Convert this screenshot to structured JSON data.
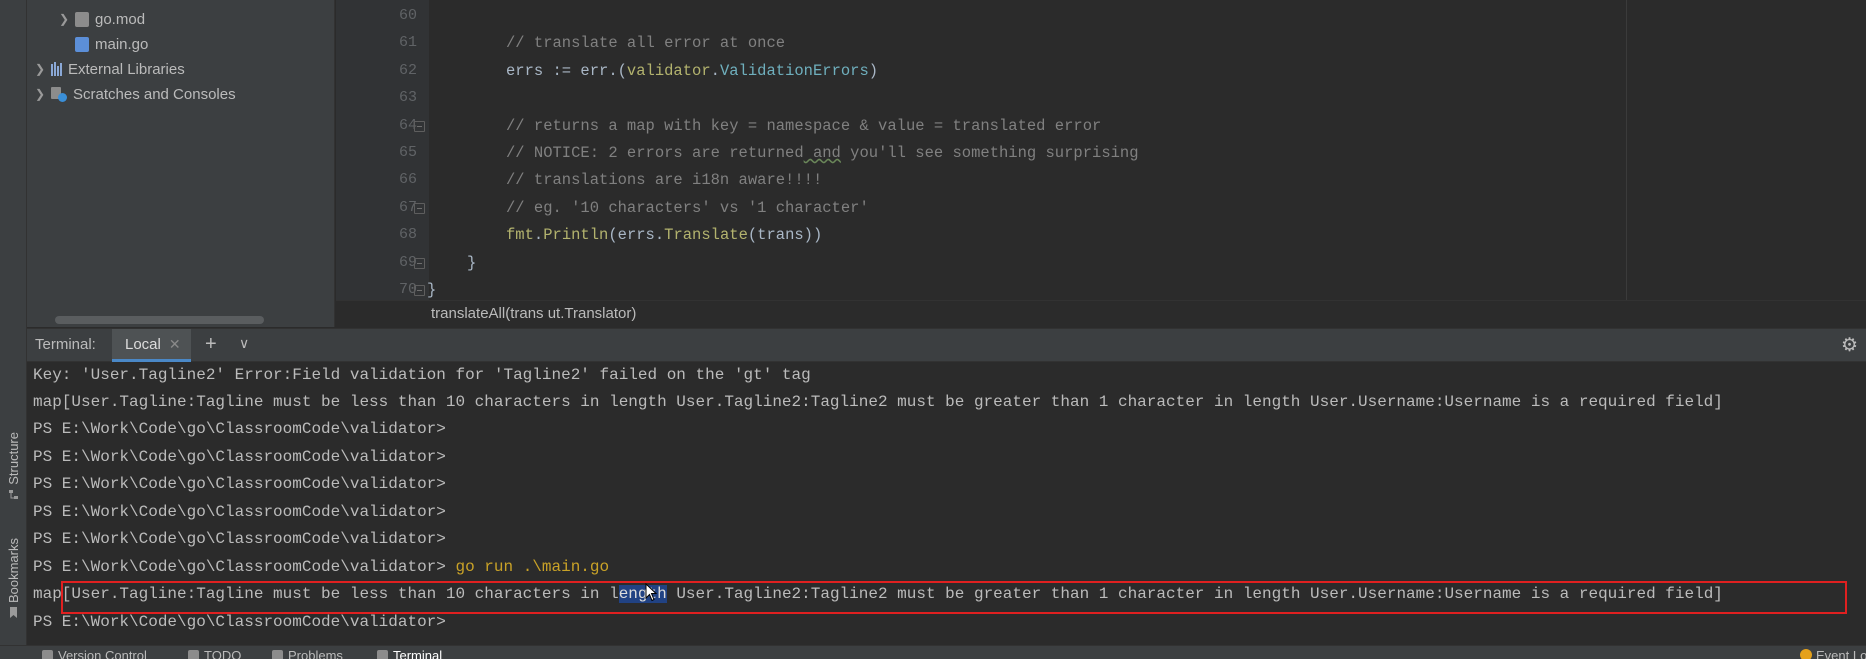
{
  "project_tree": {
    "items": [
      {
        "label": "go.mod",
        "icon": "go-mod-file-icon",
        "expandable": true
      },
      {
        "label": "main.go",
        "icon": "go-file-icon",
        "expandable": false
      },
      {
        "label": "External Libraries",
        "icon": "library-icon",
        "expandable": true
      },
      {
        "label": "Scratches and Consoles",
        "icon": "scratches-icon",
        "expandable": true
      }
    ]
  },
  "left_stripe": {
    "structure_label": "Structure",
    "bookmarks_label": "Bookmarks"
  },
  "editor": {
    "line_numbers": [
      "60",
      "61",
      "62",
      "63",
      "64",
      "65",
      "66",
      "67",
      "68",
      "69",
      "70"
    ],
    "lines": {
      "l61": "// translate all error at once",
      "l62_var": "errs := err.(",
      "l62_pkg": "validator",
      "l62_dot": ".",
      "l62_type": "ValidationErrors",
      "l62_close": ")",
      "l64": "// returns a map with key = namespace & value = translated error",
      "l65_a": "// NOTICE: 2 errors are returned",
      "l65_b": " and",
      "l65_c": " you'll see something surprising",
      "l66": "// translations are i18n aware!!!!",
      "l67": "// eg. '10 characters' vs '1 character'",
      "l68_pkg": "fmt",
      "l68_dot": ".",
      "l68_fn": "Println",
      "l68_open": "(errs.",
      "l68_fn2": "Translate",
      "l68_close": "(trans))",
      "l69": "}",
      "l70": "}"
    },
    "breadcrumb": "translateAll(trans ut.Translator)"
  },
  "terminal": {
    "title": "Terminal:",
    "tab_label": "Local",
    "lines": {
      "t1": "Key: 'User.Tagline2' Error:Field validation for 'Tagline2' failed on the 'gt' tag",
      "t2": "map[User.Tagline:Tagline must be less than 10 characters in length User.Tagline2:Tagline2 must be greater than 1 character in length User.Username:Username is a required field]",
      "prompt": "PS E:\\Work\\Code\\go\\ClassroomCode\\validator>",
      "command": " go run .\\main.go",
      "t9_a": "map[User.Tagline:Tagline must be less than 10 characters in l",
      "t9_sel": "ength",
      "t9_b": " User.Tagline2:Tagline2 must be greater than 1 character in length User.Username:Username is a required field]"
    }
  },
  "bottom_bar": {
    "version_control": "Version Control",
    "todo": "TODO",
    "problems": "Problems",
    "terminal": "Terminal",
    "event_log": "Event Log"
  },
  "colors": {
    "background": "#2b2b2b",
    "panel": "#3c3f41",
    "selection": "#214283",
    "highlight_box": "#e02020",
    "command": "#c9a227"
  }
}
